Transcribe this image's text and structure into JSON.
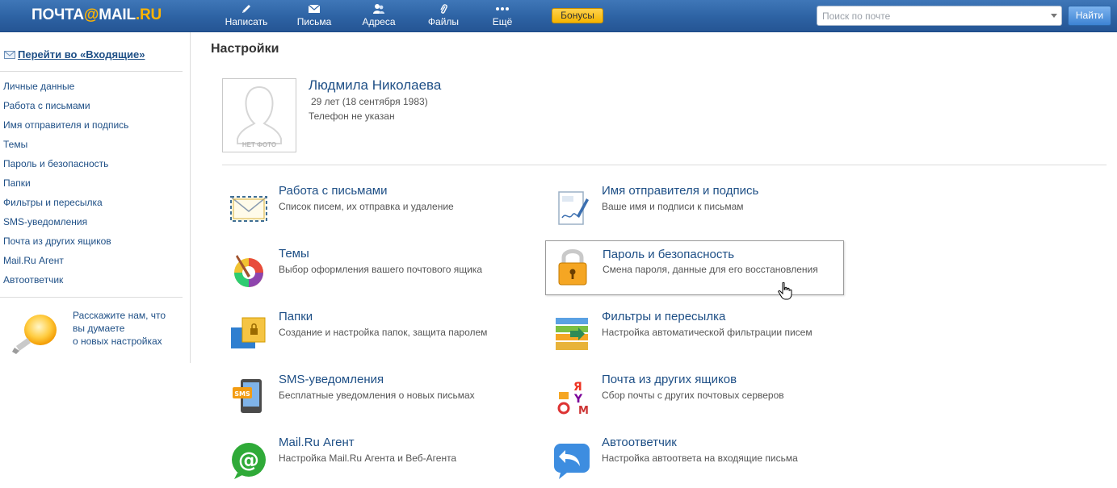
{
  "colors": {
    "topbar": "#2d62a3",
    "link": "#1e4f86",
    "bonus": "#f4b400",
    "logo_accent": "#ffb400"
  },
  "header": {
    "logo": {
      "part1": "ПОЧТА",
      "at": "@",
      "part2": "MAIL",
      "part3": ".RU"
    },
    "nav": [
      {
        "label": "Написать",
        "icon": "pencil-icon"
      },
      {
        "label": "Письма",
        "icon": "envelope-icon"
      },
      {
        "label": "Адреса",
        "icon": "contacts-icon"
      },
      {
        "label": "Файлы",
        "icon": "paperclip-icon"
      },
      {
        "label": "Ещё",
        "icon": "more-dots-icon"
      }
    ],
    "bonus_label": "Бонусы",
    "search_placeholder": "Поиск по почте",
    "find_label": "Найти"
  },
  "sidebar": {
    "inbox_link": "Перейти во «Входящие»",
    "items": [
      {
        "label": "Личные данные"
      },
      {
        "label": "Работа с письмами"
      },
      {
        "label": "Имя отправителя и подпись"
      },
      {
        "label": "Темы"
      },
      {
        "label": "Пароль и безопасность"
      },
      {
        "label": "Папки"
      },
      {
        "label": "Фильтры и пересылка"
      },
      {
        "label": "SMS-уведомления"
      },
      {
        "label": "Почта из других ящиков"
      },
      {
        "label": "Mail.Ru Агент"
      },
      {
        "label": "Автоответчик"
      }
    ],
    "feedback": {
      "line1": "Расскажите нам, что",
      "line2": "вы думаете",
      "line3": "о новых настройках"
    }
  },
  "main": {
    "title": "Настройки",
    "profile": {
      "name": "Людмила Николаева",
      "age": "29 лет (18 сентября 1983)",
      "phone": "Телефон не указан",
      "no_photo": "НЕТ ФОТО"
    },
    "tiles": [
      {
        "title": "Работа с письмами",
        "desc": "Список писем, их отправка и удаление",
        "icon": "envelope-icon"
      },
      {
        "title": "Имя отправителя и подпись",
        "desc": "Ваше имя и подписи к письмам",
        "icon": "signature-icon"
      },
      {
        "title": "Темы",
        "desc": "Выбор оформления вашего почтового ящика",
        "icon": "palette-icon"
      },
      {
        "title": "Пароль и безопасность",
        "desc": "Смена пароля, данные для его восстановления",
        "icon": "padlock-icon"
      },
      {
        "title": "Папки",
        "desc": "Создание и настройка папок, защита паролем",
        "icon": "folders-icon"
      },
      {
        "title": "Фильтры и пересылка",
        "desc": "Настройка автоматической фильтрации писем",
        "icon": "filter-stack-icon"
      },
      {
        "title": "SMS-уведомления",
        "desc": "Бесплатные уведомления о новых письмах",
        "icon": "sms-phone-icon"
      },
      {
        "title": "Почта из других ящиков",
        "desc": "Сбор почты с других почтовых серверов",
        "icon": "mail-collector-icon",
        "letters": {
          "ya": "Я",
          "y": "Y",
          "m": "M"
        }
      },
      {
        "title": "Mail.Ru Агент",
        "desc": "Настройка Mail.Ru Агента и Веб-Агента",
        "icon": "agent-at-icon"
      },
      {
        "title": "Автоответчик",
        "desc": "Настройка автоответа на входящие письма",
        "icon": "autoreply-icon"
      }
    ]
  }
}
